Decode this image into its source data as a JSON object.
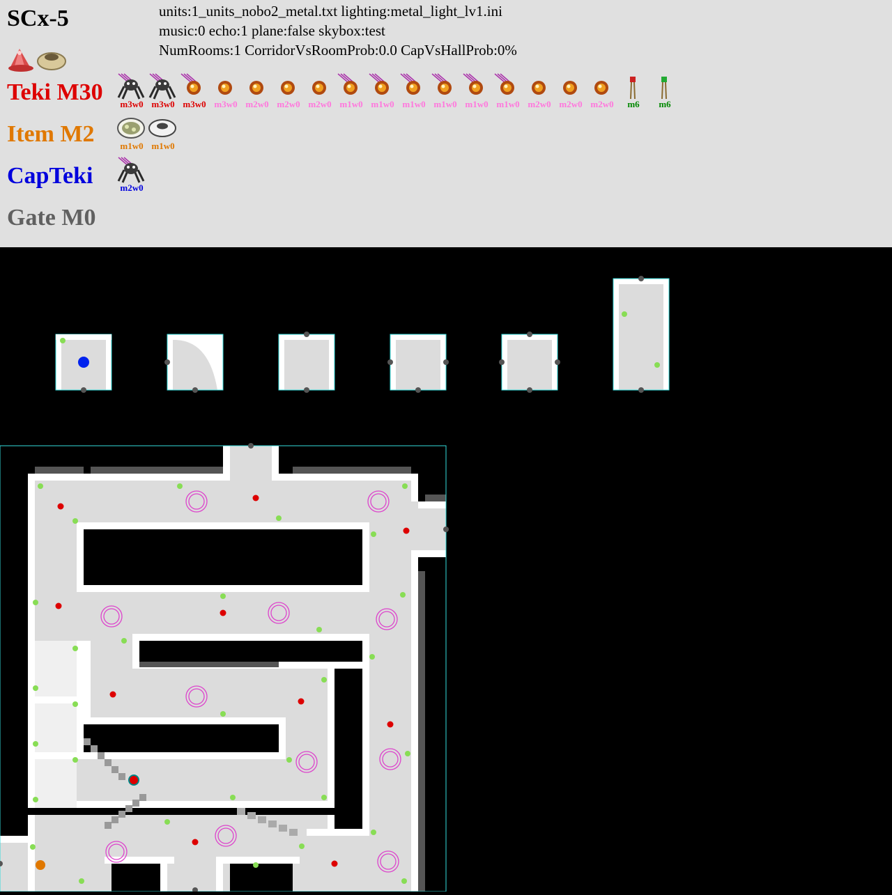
{
  "header": {
    "sublevel": "SCx-5",
    "info_lines": [
      "units:1_units_nobo2_metal.txt   lighting:metal_light_lv1.ini",
      "music:0   echo:1   plane:false   skybox:test",
      "NumRooms:1   CorridorVsRoomProb:0.0   CapVsHallProb:0%"
    ],
    "teki_label": "Teki M30",
    "item_label": "Item M2",
    "capteki_label": "CapTeki",
    "gate_label": "Gate M0",
    "colors": {
      "teki": "#dd0000",
      "item": "#e07800",
      "capteki": "#0000dd",
      "gate": "#606060",
      "pink": "#ff77dd",
      "green": "#008800"
    }
  },
  "teki": [
    {
      "icon": "spider-icon",
      "label": "m3w0",
      "color": "red",
      "falling": true
    },
    {
      "icon": "spider-icon",
      "label": "m3w0",
      "color": "red",
      "falling": true
    },
    {
      "icon": "bomb-rock-icon",
      "label": "m3w0",
      "color": "red",
      "falling": true
    },
    {
      "icon": "bomb-rock-icon",
      "label": "m3w0",
      "color": "pink",
      "falling": false
    },
    {
      "icon": "bomb-rock-icon",
      "label": "m2w0",
      "color": "pink",
      "falling": false
    },
    {
      "icon": "bomb-rock-icon",
      "label": "m2w0",
      "color": "pink",
      "falling": false
    },
    {
      "icon": "bomb-rock-icon",
      "label": "m2w0",
      "color": "pink",
      "falling": false
    },
    {
      "icon": "bomb-rock-icon",
      "label": "m1w0",
      "color": "pink",
      "falling": true
    },
    {
      "icon": "bomb-rock-icon",
      "label": "m1w0",
      "color": "pink",
      "falling": true
    },
    {
      "icon": "bomb-rock-icon",
      "label": "m1w0",
      "color": "pink",
      "falling": true
    },
    {
      "icon": "bomb-rock-icon",
      "label": "m1w0",
      "color": "pink",
      "falling": true
    },
    {
      "icon": "bomb-rock-icon",
      "label": "m1w0",
      "color": "pink",
      "falling": true
    },
    {
      "icon": "bomb-rock-icon",
      "label": "m1w0",
      "color": "pink",
      "falling": true
    },
    {
      "icon": "bomb-rock-icon",
      "label": "m2w0",
      "color": "pink",
      "falling": false
    },
    {
      "icon": "bomb-rock-icon",
      "label": "m2w0",
      "color": "pink",
      "falling": false
    },
    {
      "icon": "bomb-rock-icon",
      "label": "m2w0",
      "color": "pink",
      "falling": false
    },
    {
      "icon": "red-flower-stalk-icon",
      "label": "m6",
      "color": "green",
      "falling": false
    },
    {
      "icon": "green-flower-stalk-icon",
      "label": "m6",
      "color": "green",
      "falling": false
    }
  ],
  "items": [
    {
      "icon": "spotted-disc-icon",
      "label": "m1w0"
    },
    {
      "icon": "ring-disc-icon",
      "label": "m1w0"
    }
  ],
  "capteki": [
    {
      "icon": "spider-icon",
      "label": "m2w0",
      "falling": true
    }
  ]
}
